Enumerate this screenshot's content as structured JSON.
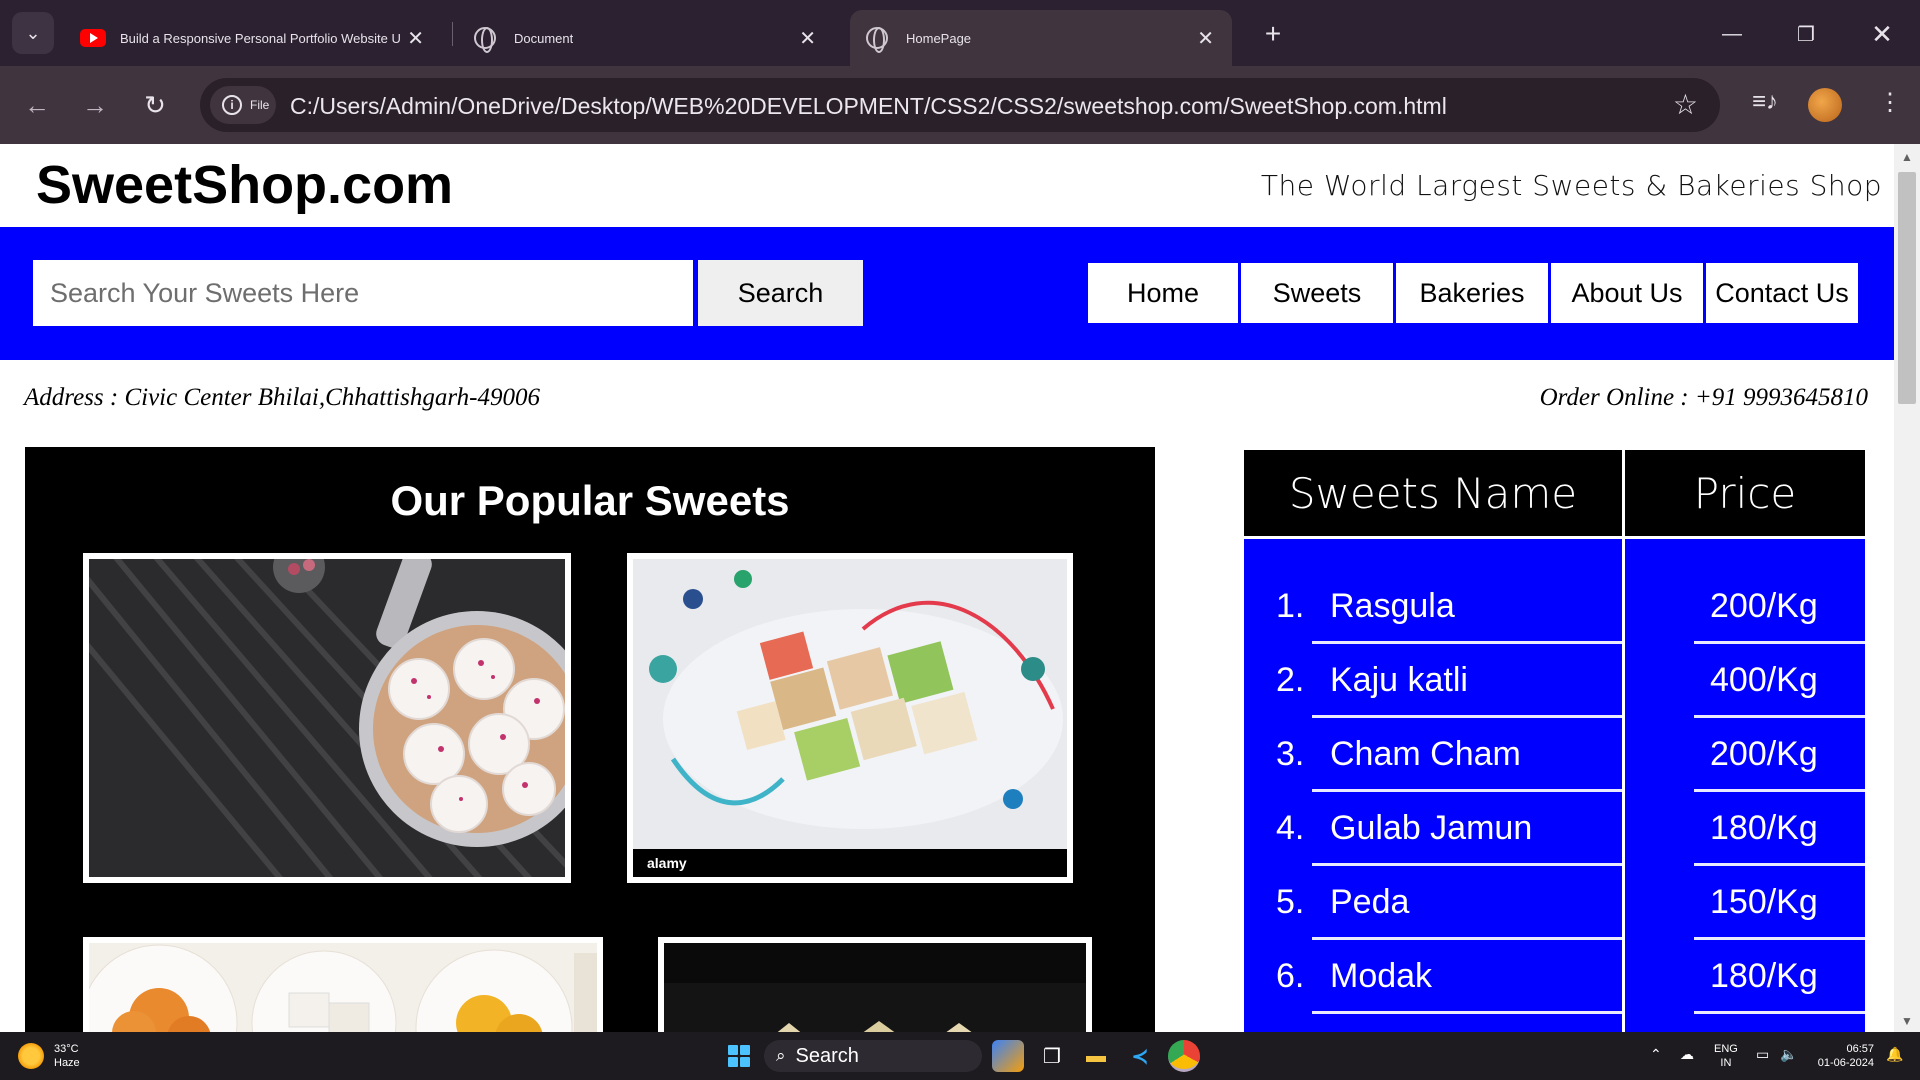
{
  "browser": {
    "tabs": [
      {
        "title": "Build a Responsive Personal Portfolio Website Using H",
        "favicon": "youtube-icon"
      },
      {
        "title": "Document",
        "favicon": "globe-icon"
      },
      {
        "title": "HomePage",
        "favicon": "globe-icon",
        "active": true
      }
    ],
    "site_chip": "File",
    "url": "C:/Users/Admin/OneDrive/Desktop/WEB%20DEVELOPMENT/CSS2/CSS2/sweetshop.com/SweetShop.com.html"
  },
  "site": {
    "logo": "SweetShop.com",
    "tagline": "The World Largest Sweets & Bakeries Shop",
    "search_placeholder": "Search Your Sweets Here",
    "search_button": "Search",
    "nav": [
      "Home",
      "Sweets",
      "Bakeries",
      "About Us",
      "Contact Us"
    ],
    "address": "Address : Civic Center Bhilai,Chhattishgarh-49006",
    "order": "Order Online : +91 9993645810",
    "popular_title": "Our Popular Sweets",
    "photo_watermark": "alamy",
    "table": {
      "headers": [
        "Sweets Name",
        "Price"
      ],
      "rows": [
        {
          "num": "1.",
          "name": "Rasgula",
          "price": "200/Kg"
        },
        {
          "num": "2.",
          "name": "Kaju katli",
          "price": "400/Kg"
        },
        {
          "num": "3.",
          "name": "Cham Cham",
          "price": "200/Kg"
        },
        {
          "num": "4.",
          "name": "Gulab Jamun",
          "price": "180/Kg"
        },
        {
          "num": "5.",
          "name": "Peda",
          "price": "150/Kg"
        },
        {
          "num": "6.",
          "name": "Modak",
          "price": "180/Kg"
        }
      ]
    }
  },
  "taskbar": {
    "temperature": "33°C",
    "weather": "Haze",
    "search": "Search",
    "lang_top": "ENG",
    "lang_bottom": "IN",
    "time": "06:57",
    "date": "01-06-2024"
  },
  "colors": {
    "brand_blue": "#0000ff",
    "chrome_bg": "#2b2130",
    "toolbar_bg": "#40343f"
  }
}
